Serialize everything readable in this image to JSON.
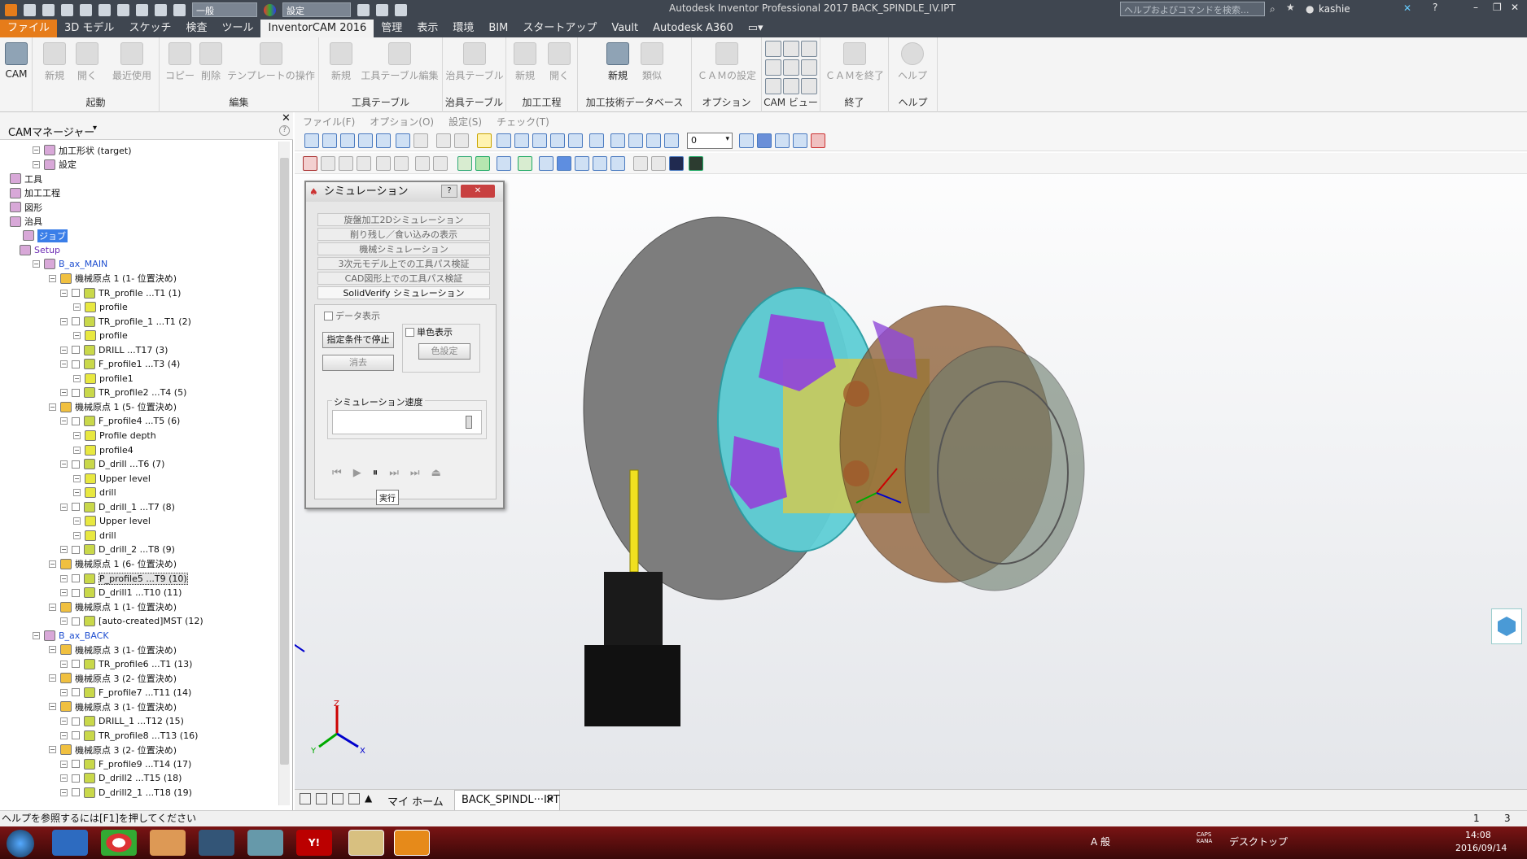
{
  "title": "Autodesk Inventor Professional 2017   BACK_SPINDLE_IV.IPT",
  "quick_dropdown_1": "一般",
  "quick_dropdown_2": "設定",
  "search_placeholder": "ヘルプおよびコマンドを検索...",
  "user": "kashie",
  "menu": [
    "ファイル",
    "3D モデル",
    "スケッチ",
    "検査",
    "ツール",
    "InventorCAM 2016",
    "管理",
    "表示",
    "環境",
    "BIM",
    "スタートアップ",
    "Vault",
    "Autodesk A360"
  ],
  "ribbon": {
    "cam": "CAM",
    "kidou": {
      "items": [
        "新規",
        "開く",
        "最近使用"
      ],
      "label": "起動"
    },
    "henshu": {
      "items": [
        "コピー",
        "削除",
        "テンプレートの操作"
      ],
      "label": "編集"
    },
    "tool": {
      "items": [
        "新規",
        "工具テーブル編集"
      ],
      "label": "工具テーブル"
    },
    "jig": {
      "items": [
        "治具テーブル"
      ],
      "label": "治具テーブル"
    },
    "proc": {
      "items": [
        "新規",
        "開く"
      ],
      "label": "加工工程"
    },
    "tech": {
      "items": [
        "新規",
        "類似"
      ],
      "label": "加工技術データベース"
    },
    "opt": {
      "items": [
        "ＣＡＭの設定"
      ],
      "label": "オプション"
    },
    "view": {
      "label": "CAM ビュー"
    },
    "end": {
      "items": [
        "ＣＡＭを終了"
      ],
      "label": "終了"
    },
    "help": {
      "items": [
        "ヘルプ"
      ],
      "label": "ヘルプ"
    }
  },
  "cam_manager": "CAMマネージャー",
  "tree": [
    {
      "d": 3,
      "t": "加工形状 (target)"
    },
    {
      "d": 3,
      "t": "設定"
    },
    {
      "d": 1,
      "t": "工具"
    },
    {
      "d": 1,
      "t": "加工工程"
    },
    {
      "d": 1,
      "t": "図形"
    },
    {
      "d": 1,
      "t": "治具"
    },
    {
      "d": 0,
      "t": "ジョブ",
      "hl": true
    },
    {
      "d": 2,
      "t": "Setup",
      "c": "purple"
    },
    {
      "d": 3,
      "t": "B_ax_MAIN",
      "c": "blue"
    },
    {
      "d": 4,
      "t": "機械原点 1 (1- 位置決め)"
    },
    {
      "d": 5,
      "t": "TR_profile ...T1 (1)"
    },
    {
      "d": 6,
      "t": "profile"
    },
    {
      "d": 5,
      "t": "TR_profile_1 ...T1 (2)"
    },
    {
      "d": 6,
      "t": "profile"
    },
    {
      "d": 5,
      "t": "DRILL ...T17 (3)"
    },
    {
      "d": 5,
      "t": "F_profile1 ...T3 (4)"
    },
    {
      "d": 6,
      "t": "profile1"
    },
    {
      "d": 5,
      "t": "TR_profile2 ...T4 (5)"
    },
    {
      "d": 4,
      "t": "機械原点 1 (5- 位置決め)"
    },
    {
      "d": 5,
      "t": "F_profile4 ...T5 (6)"
    },
    {
      "d": 6,
      "t": "Profile depth"
    },
    {
      "d": 6,
      "t": "profile4"
    },
    {
      "d": 5,
      "t": "D_drill ...T6 (7)"
    },
    {
      "d": 6,
      "t": "Upper level"
    },
    {
      "d": 6,
      "t": "drill"
    },
    {
      "d": 5,
      "t": "D_drill_1 ...T7 (8)"
    },
    {
      "d": 6,
      "t": "Upper level"
    },
    {
      "d": 6,
      "t": "drill"
    },
    {
      "d": 5,
      "t": "D_drill_2 ...T8 (9)"
    },
    {
      "d": 4,
      "t": "機械原点 1 (6- 位置決め)"
    },
    {
      "d": 5,
      "t": "P_profile5 ...T9 (10)",
      "sel": true
    },
    {
      "d": 5,
      "t": "D_drill1 ...T10 (11)"
    },
    {
      "d": 4,
      "t": "機械原点 1 (1- 位置決め)"
    },
    {
      "d": 5,
      "t": "[auto-created]MST (12)"
    },
    {
      "d": 3,
      "t": "B_ax_BACK",
      "c": "blue"
    },
    {
      "d": 4,
      "t": "機械原点 3 (1- 位置決め)"
    },
    {
      "d": 5,
      "t": "TR_profile6 ...T1 (13)"
    },
    {
      "d": 4,
      "t": "機械原点 3 (2- 位置決め)"
    },
    {
      "d": 5,
      "t": "F_profile7 ...T11 (14)"
    },
    {
      "d": 4,
      "t": "機械原点 3 (1- 位置決め)"
    },
    {
      "d": 5,
      "t": "DRILL_1 ...T12 (15)"
    },
    {
      "d": 5,
      "t": "TR_profile8 ...T13 (16)"
    },
    {
      "d": 4,
      "t": "機械原点 3 (2- 位置決め)"
    },
    {
      "d": 5,
      "t": "F_profile9 ...T14 (17)"
    },
    {
      "d": 5,
      "t": "D_drill2 ...T15 (18)"
    },
    {
      "d": 5,
      "t": "D_drill2_1 ...T18 (19)"
    }
  ],
  "viewport_menu": [
    "ファイル(F)",
    "オプション(O)",
    "設定(S)",
    "チェック(T)"
  ],
  "viewport_combo": "0",
  "sim": {
    "title": "シミュレーション",
    "modes": [
      "旋盤加工2Dシミュレーション",
      "削り残し／食い込みの表示",
      "機械シミュレーション",
      "3次元モデル上での工具パス検証",
      "CAD図形上での工具パス検証",
      "SolidVerify シミュレーション"
    ],
    "data_display": "データ表示",
    "stop_btn": "指定条件で停止",
    "clear_btn": "消去",
    "mono": "単色表示",
    "color_btn": "色設定",
    "speed_label": "シミュレーション速度",
    "speed": 0.95,
    "tooltip": "実行"
  },
  "tabs": [
    "マイ ホーム",
    "BACK_SPINDL···IPT"
  ],
  "status": {
    "help": "ヘルプを参照するには[F1]を押してください",
    "n1": "1",
    "n2": "3"
  },
  "taskbar": {
    "desktop": "デスクトップ",
    "time": "14:08",
    "date": "2016/09/14",
    "ime": "A 般",
    "caps": "CAPS KANA"
  }
}
